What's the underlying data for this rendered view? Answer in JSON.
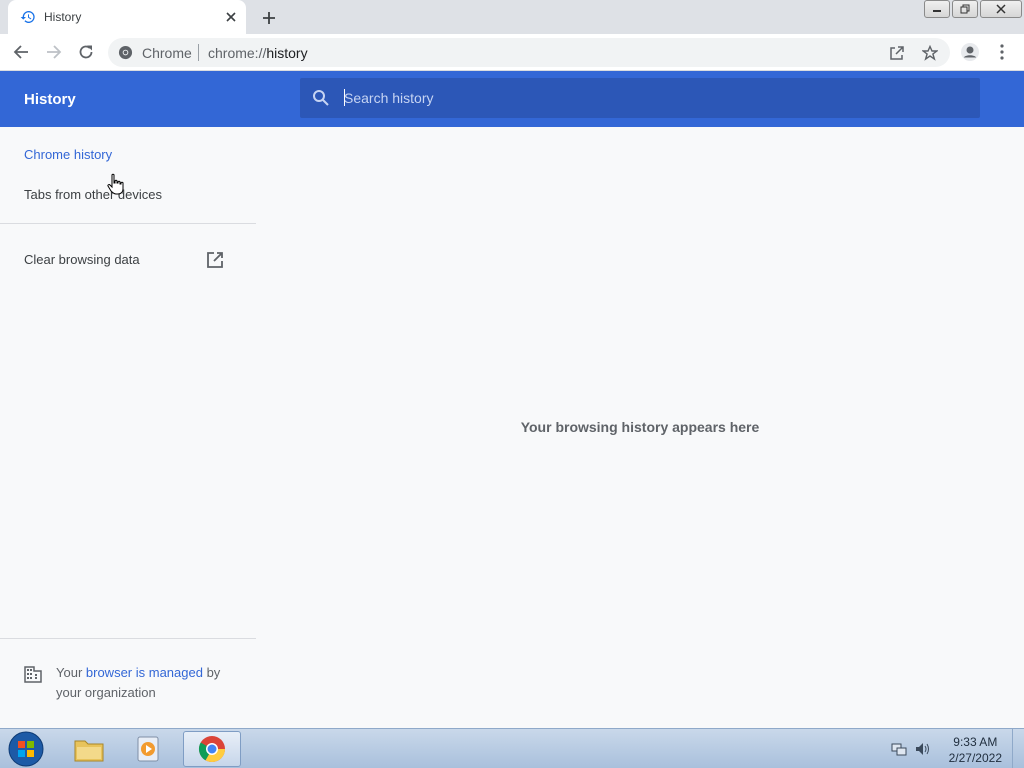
{
  "browser": {
    "tab_title": "History",
    "omnibox_site_label": "Chrome",
    "omnibox_url_scheme": "chrome://",
    "omnibox_url_path": "history"
  },
  "icons": {
    "tab": "history-icon",
    "tab_close": "close-icon",
    "new_tab": "plus-icon",
    "back": "arrow-left-icon",
    "forward": "arrow-right-icon",
    "reload": "reload-icon",
    "site_info": "chrome-logo-icon",
    "share": "share-icon",
    "bookmark": "star-icon",
    "profile": "profile-icon",
    "menu": "kebab-menu-icon",
    "search": "search-icon",
    "external_link": "open-in-new-icon",
    "managed": "building-icon"
  },
  "page": {
    "title": "History",
    "search_placeholder": "Search history",
    "empty_message": "Your browsing history appears here"
  },
  "sidebar": {
    "items": [
      {
        "label": "Chrome history",
        "active": true
      },
      {
        "label": "Tabs from other devices",
        "active": false
      }
    ],
    "clear_browsing_data": "Clear browsing data",
    "managed_prefix": "Your ",
    "managed_link": "browser is managed",
    "managed_suffix": " by your organization"
  },
  "taskbar": {
    "time": "9:33 AM",
    "date": "2/27/2022"
  },
  "colors": {
    "accent": "#3367d6",
    "search_box": "#2c57b7",
    "background": "#f8f9fa"
  }
}
